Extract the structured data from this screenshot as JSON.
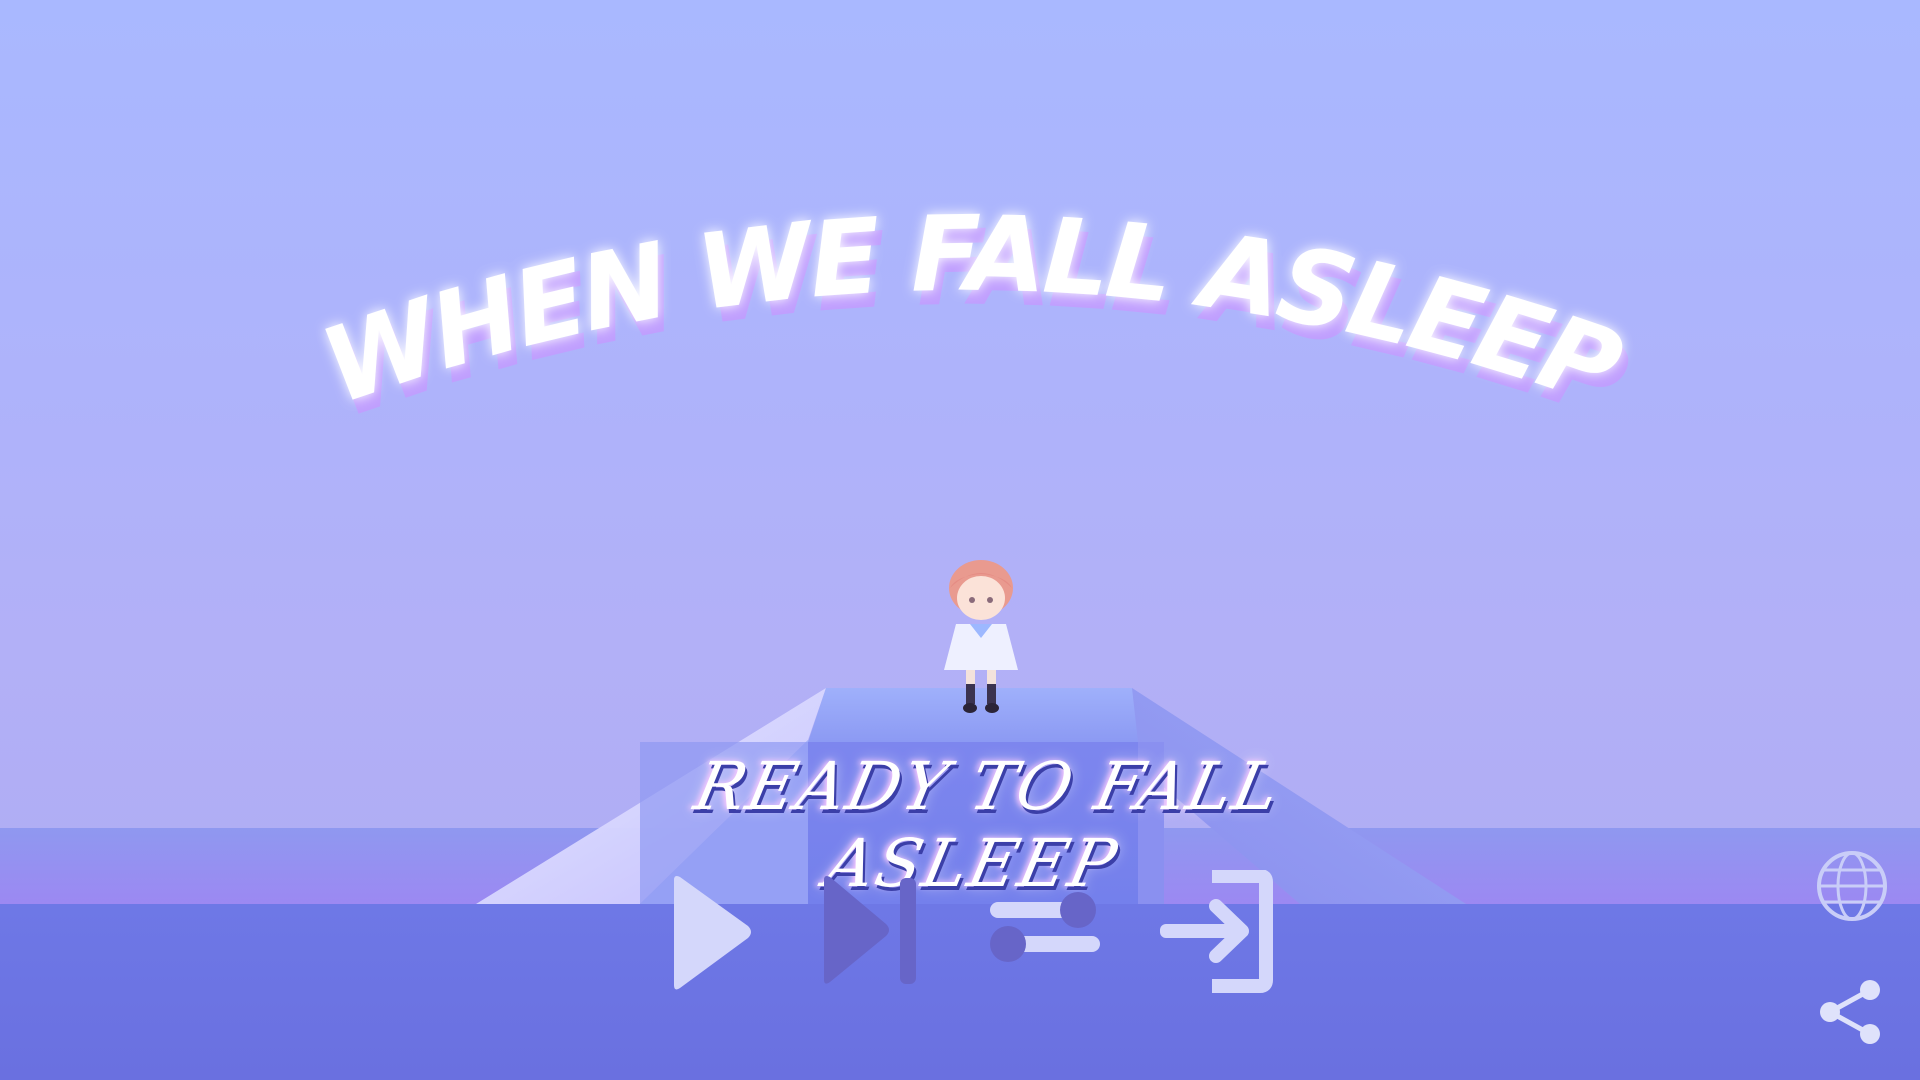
{
  "game": {
    "title": "WHEN WE FALL ASLEEP",
    "subtitle": "READY TO FALL ASLEEP"
  },
  "controls": {
    "play": "play-icon",
    "skip": "skip-next-icon",
    "settings": "toggle-settings-icon",
    "exit": "exit-icon"
  },
  "side": {
    "language": "globe-icon",
    "share": "share-icon"
  },
  "colors": {
    "sky": "#aab5fd",
    "floor": "#6b74e4",
    "title": "#ffffff",
    "title_shadow": "#d6a6ff",
    "control_light": "#d4d7fb",
    "control_dim": "#6765c8"
  }
}
